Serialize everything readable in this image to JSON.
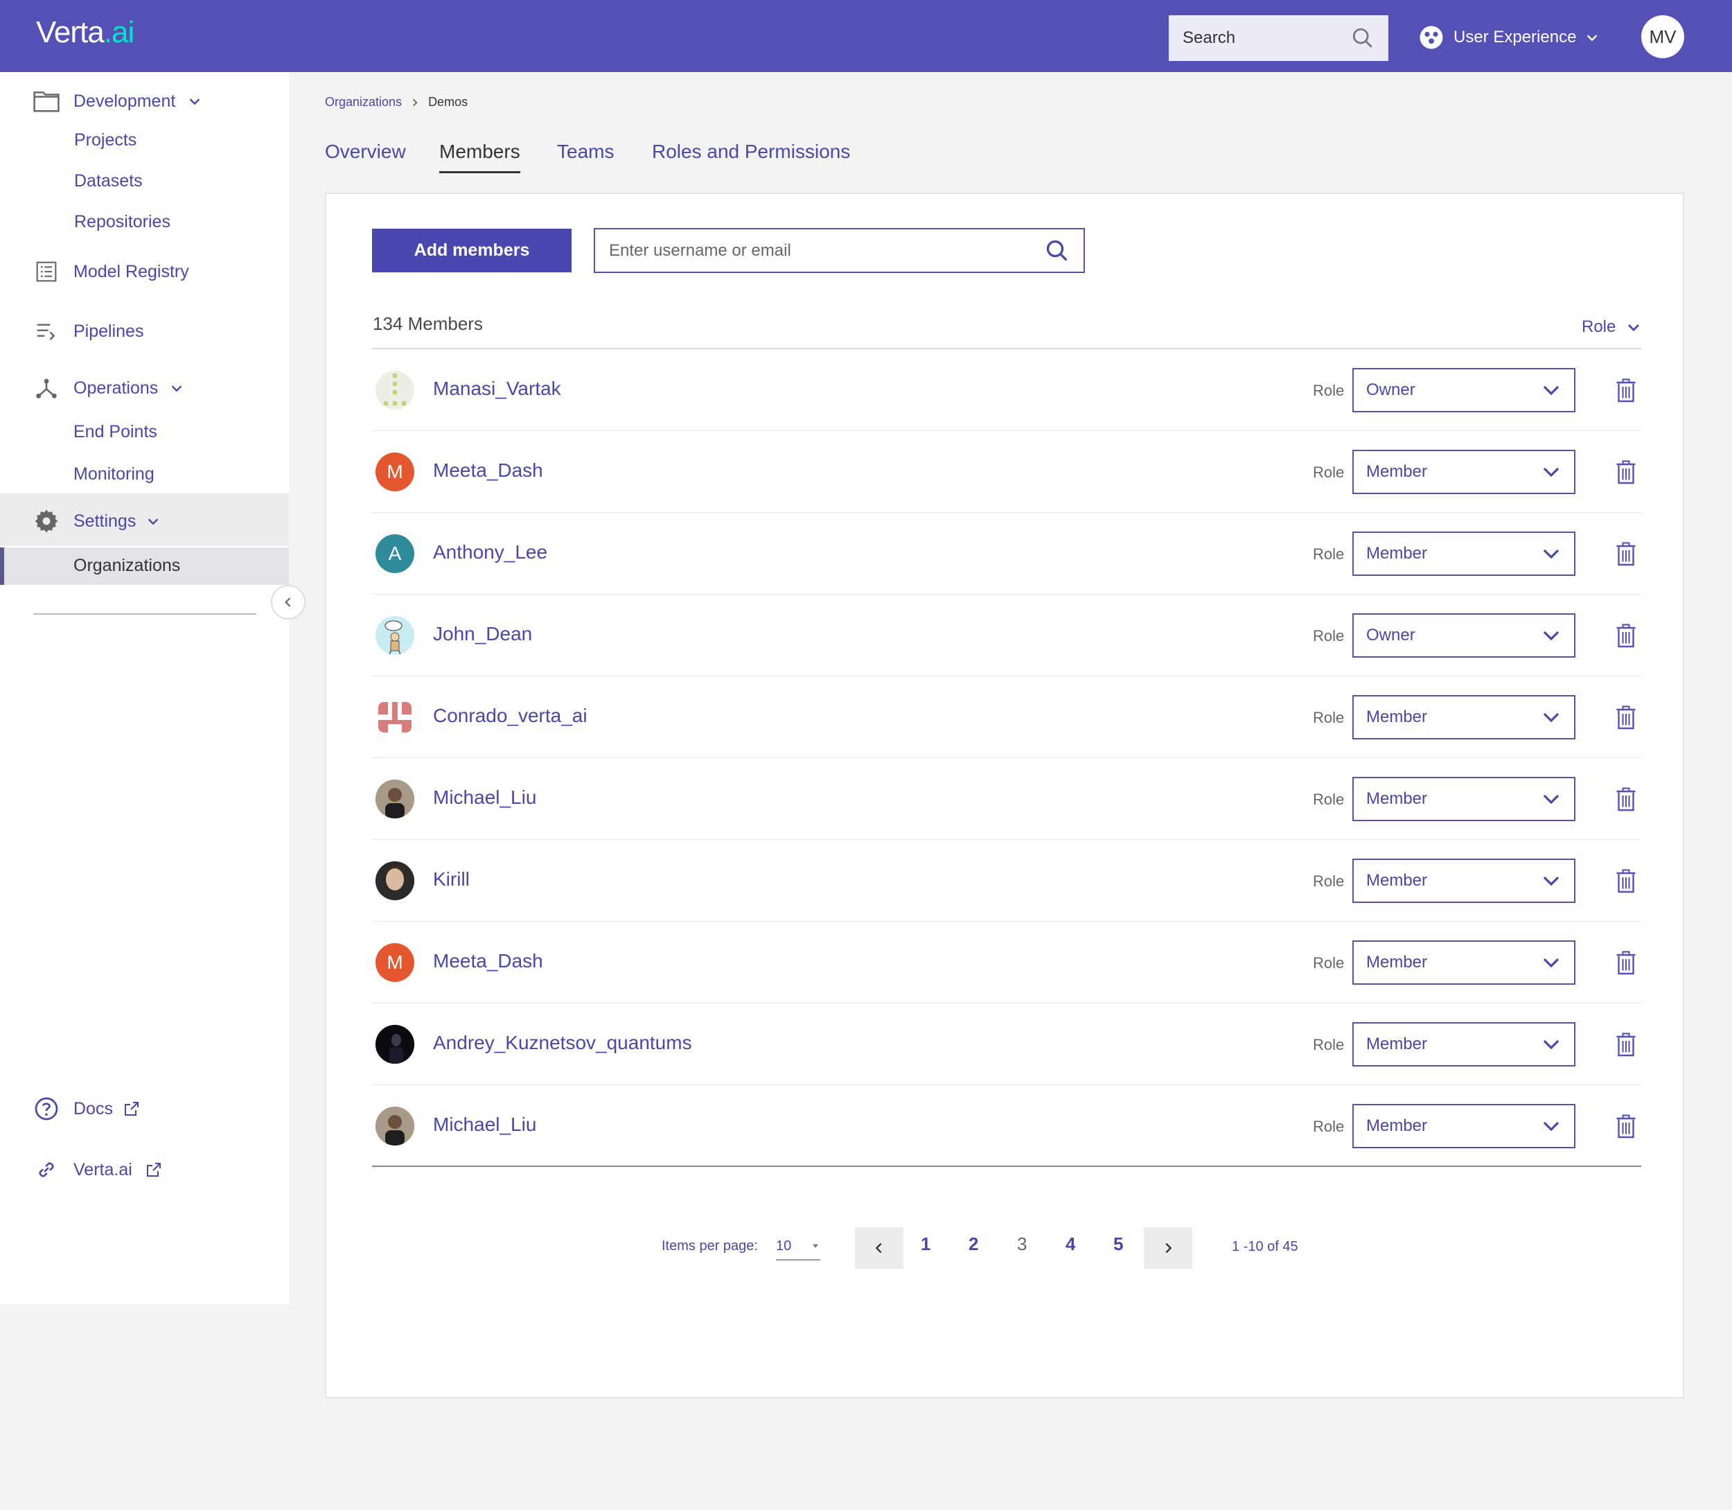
{
  "header": {
    "logo_main": "Verta",
    "logo_dot": ".ai",
    "search_label": "Search",
    "workspace": "User Experience",
    "user_initials": "MV"
  },
  "sidebar": {
    "development": "Development",
    "projects": "Projects",
    "datasets": "Datasets",
    "repositories": "Repositories",
    "model_registry": "Model Registry",
    "pipelines": "Pipelines",
    "operations": "Operations",
    "end_points": "End Points",
    "monitoring": "Monitoring",
    "settings": "Settings",
    "organizations": "Organizations",
    "docs": "Docs",
    "verta_ai": "Verta.ai"
  },
  "breadcrumb": {
    "parent": "Organizations",
    "current": "Demos"
  },
  "tabs": [
    "Overview",
    "Members",
    "Teams",
    "Roles and Permissions"
  ],
  "toolbar": {
    "add_members": "Add members",
    "search_placeholder": "Enter username or email"
  },
  "list": {
    "count_label": "134 Members",
    "role_filter": "Role",
    "role_label": "Role",
    "members": [
      {
        "name": "Manasi_Vartak",
        "role": "Owner",
        "avatar": "pattern-yellow",
        "initial": ""
      },
      {
        "name": "Meeta_Dash",
        "role": "Member",
        "avatar": "orange",
        "initial": "M"
      },
      {
        "name": "Anthony_Lee",
        "role": "Member",
        "avatar": "teal",
        "initial": "A"
      },
      {
        "name": "John_Dean",
        "role": "Owner",
        "avatar": "cartoon",
        "initial": ""
      },
      {
        "name": "Conrado_verta_ai",
        "role": "Member",
        "avatar": "pattern-red",
        "initial": ""
      },
      {
        "name": "Michael_Liu",
        "role": "Member",
        "avatar": "photo",
        "initial": ""
      },
      {
        "name": "Kirill",
        "role": "Member",
        "avatar": "photo",
        "initial": ""
      },
      {
        "name": "Meeta_Dash",
        "role": "Member",
        "avatar": "orange",
        "initial": "M"
      },
      {
        "name": "Andrey_Kuznetsov_quantums",
        "role": "Member",
        "avatar": "photo-dark",
        "initial": ""
      },
      {
        "name": "Michael_Liu",
        "role": "Member",
        "avatar": "photo",
        "initial": ""
      }
    ]
  },
  "pagination": {
    "items_per_page_label": "Items per page:",
    "items_per_page": "10",
    "pages": [
      "1",
      "2",
      "3",
      "4",
      "5"
    ],
    "current_page": "3",
    "range": "1 -10 of 45"
  },
  "colors": {
    "brand": "#5450b5",
    "link": "#4a47a8",
    "avatar_orange": "#e4572e",
    "avatar_teal": "#2e8b9a"
  }
}
